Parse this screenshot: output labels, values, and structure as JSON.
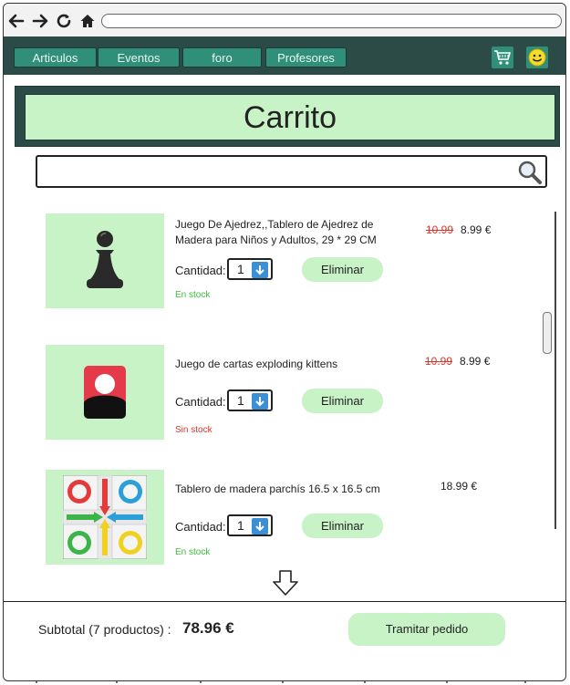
{
  "browser": {
    "back_icon": "arrow-left-icon",
    "forward_icon": "arrow-right-icon",
    "reload_icon": "reload-icon",
    "home_icon": "home-icon",
    "url": ""
  },
  "menu": {
    "items": [
      {
        "label": "Articulos"
      },
      {
        "label": "Eventos"
      },
      {
        "label": "foro"
      },
      {
        "label": "Profesores"
      }
    ],
    "cart_icon": "shopping-cart-icon",
    "profile_icon": "smiley-icon"
  },
  "page_title": "Carrito",
  "search": {
    "value": "",
    "placeholder": "",
    "icon": "search-icon"
  },
  "items": [
    {
      "name": "Juego De Ajedrez,,Tablero de Ajedrez de Madera para Niños y Adultos, 29 * 29 CM",
      "quantity_label": "Cantidad:",
      "quantity": "1",
      "remove_label": "Eliminar",
      "stock": "En stock",
      "old_price": "10.99",
      "price": "8.99 €",
      "image_icon": "chess-pawn-icon"
    },
    {
      "name": "Juego de cartas exploding kittens",
      "quantity_label": "Cantidad:",
      "quantity": "1",
      "remove_label": "Eliminar",
      "stock": "Sin stock",
      "old_price": "10.99",
      "price": "8.99  €",
      "image_icon": "card-game-icon"
    },
    {
      "name": "Tablero de madera parchís 16.5 x 16.5 cm",
      "quantity_label": "Cantidad:",
      "quantity": "1",
      "remove_label": "Eliminar",
      "stock": "En stock",
      "old_price": "",
      "price": "18.99 €",
      "image_icon": "parchis-board-icon"
    }
  ],
  "footer": {
    "subtotal_label": "Subtotal (7 productos) :",
    "subtotal_value": "78.96 €",
    "checkout_label": "Tramitar pedido",
    "more_icon": "arrow-down-icon"
  },
  "colors": {
    "menu_bg": "#2c4a46",
    "menu_button": "#2f8f79",
    "accent_light_green": "#c8f3c6",
    "stock_in": "#3bbf3b",
    "stock_out": "#e0342b",
    "old_price": "#e0342b",
    "quantity_arrow": "#3a8fd6"
  }
}
